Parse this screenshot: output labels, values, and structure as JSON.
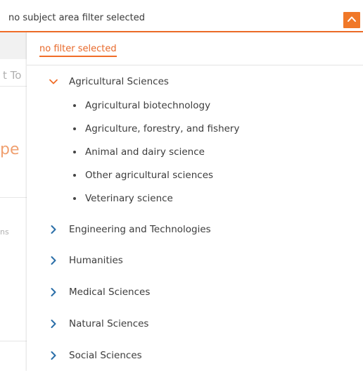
{
  "header": {
    "select_text": "no subject area filter selected",
    "toggle_icon": "chevron-up-icon"
  },
  "filter": {
    "clear_label": "no filter selected"
  },
  "background": {
    "fragment_1": "t To",
    "fragment_2": "pe",
    "fragment_3": "ns"
  },
  "tree": {
    "expanded": {
      "label": "Agricultural Sciences",
      "icon": "chevron-down-icon",
      "children": [
        "Agricultural biotechnology",
        "Agriculture, forestry, and fishery",
        "Animal and dairy science",
        "Other agricultural sciences",
        "Veterinary science"
      ]
    },
    "collapsed": [
      "Engineering and Technologies",
      "Humanities",
      "Medical Sciences",
      "Natural Sciences",
      "Social Sciences"
    ],
    "collapsed_icon": "chevron-right-icon"
  },
  "colors": {
    "accent": "#f06d28",
    "link": "#e8692a",
    "chevron_collapsed": "#2a6ea8",
    "text": "#3c3c3c"
  }
}
